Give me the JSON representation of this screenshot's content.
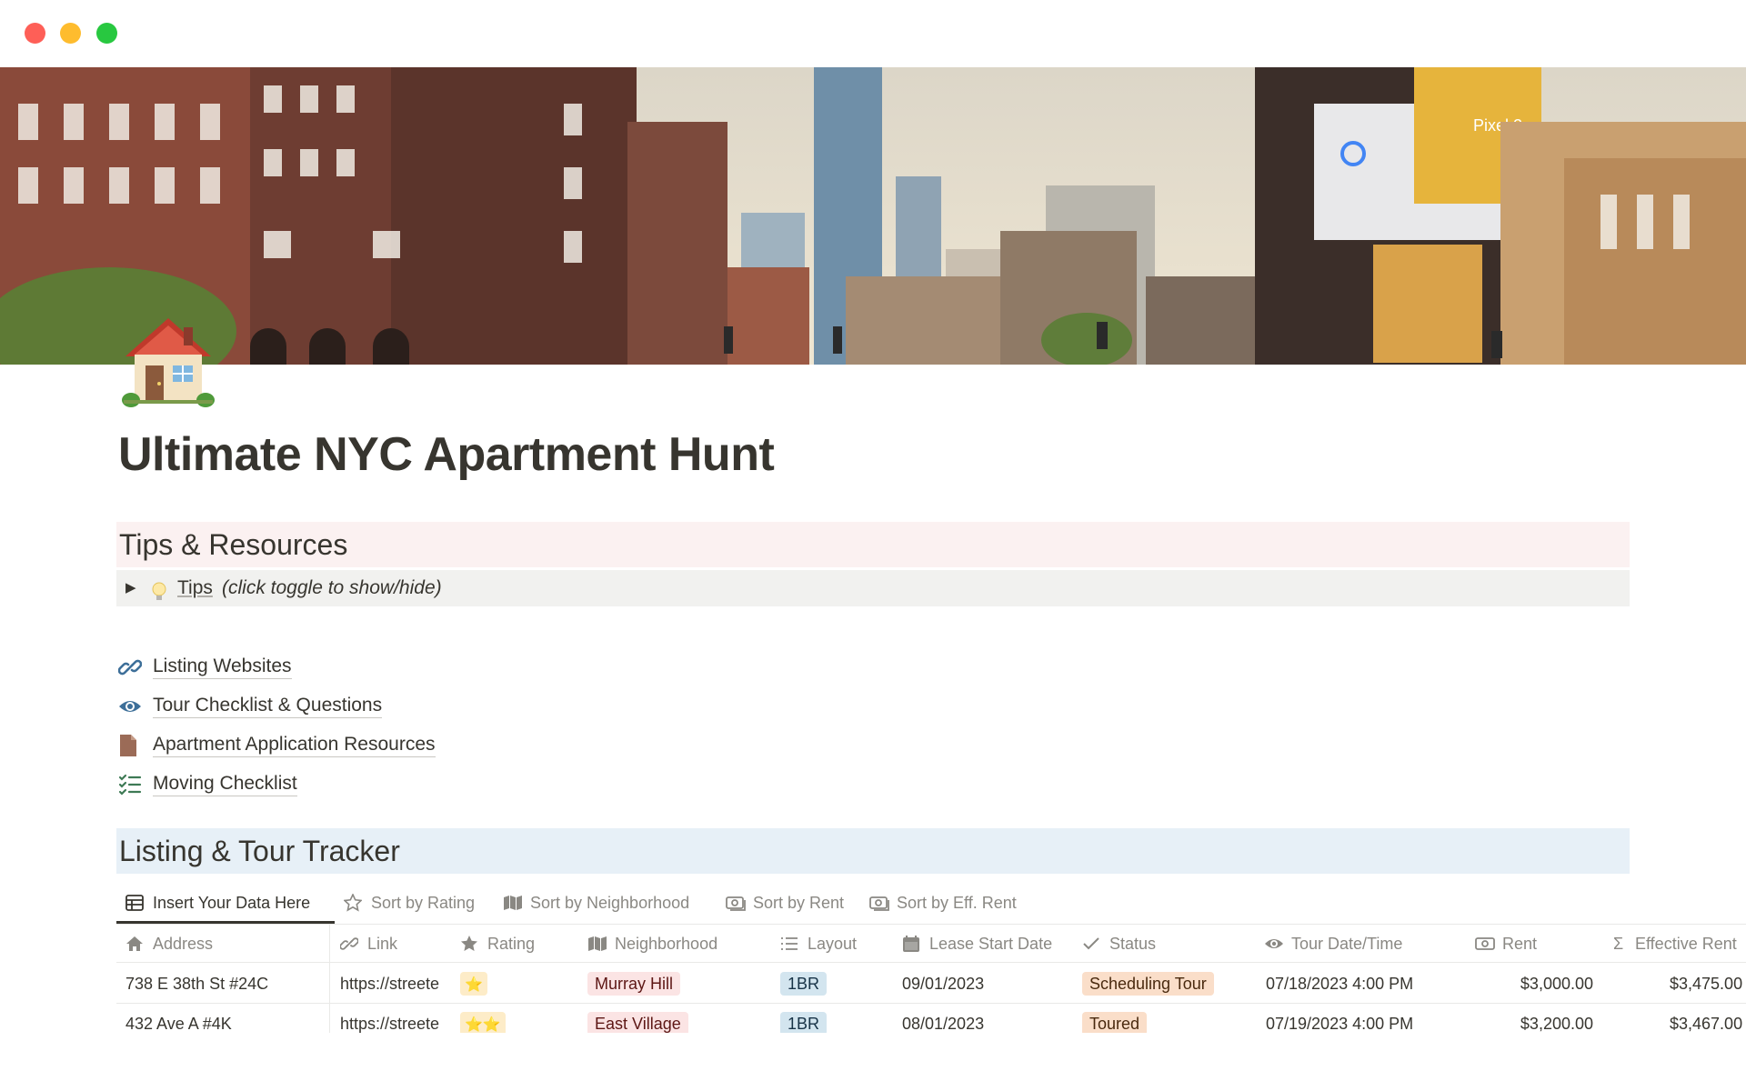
{
  "window": {
    "controls": [
      "close",
      "minimize",
      "zoom"
    ]
  },
  "cover": {
    "description_icon": "nyc-street-cover-image",
    "billboard_text": "Pixel 2"
  },
  "page": {
    "icon": "house-icon",
    "title": "Ultimate NYC Apartment Hunt"
  },
  "tips_section": {
    "heading": "Tips & Resources",
    "toggle": {
      "bulb_icon": "lightbulb-icon",
      "label": "Tips",
      "hint": "(click toggle to show/hide)"
    }
  },
  "resource_links": [
    {
      "icon": "link-icon",
      "label": "Listing Websites"
    },
    {
      "icon": "eye-icon",
      "label": "Tour Checklist & Questions"
    },
    {
      "icon": "document-icon",
      "label": "Apartment Application Resources"
    },
    {
      "icon": "checklist-icon",
      "label": "Moving Checklist"
    }
  ],
  "tracker_section": {
    "heading": "Listing & Tour Tracker",
    "views": [
      {
        "icon": "table-icon",
        "label": "Insert Your Data Here",
        "active": true
      },
      {
        "icon": "star-icon",
        "label": "Sort by Rating",
        "active": false
      },
      {
        "icon": "map-icon",
        "label": "Sort by Neighborhood",
        "active": false
      },
      {
        "icon": "money-icon",
        "label": "Sort by Rent",
        "active": false
      },
      {
        "icon": "money-icon",
        "label": "Sort by Eff. Rent",
        "active": false
      }
    ],
    "columns": [
      {
        "icon": "house-outline-icon",
        "label": "Address"
      },
      {
        "icon": "link-icon",
        "label": "Link"
      },
      {
        "icon": "star-icon",
        "label": "Rating"
      },
      {
        "icon": "map-icon",
        "label": "Neighborhood"
      },
      {
        "icon": "list-icon",
        "label": "Layout"
      },
      {
        "icon": "calendar-icon",
        "label": "Lease Start Date"
      },
      {
        "icon": "check-icon",
        "label": "Status"
      },
      {
        "icon": "eye-icon",
        "label": "Tour Date/Time"
      },
      {
        "icon": "money-icon",
        "label": "Rent"
      },
      {
        "icon": "sigma-icon",
        "label": "Effective Rent"
      }
    ],
    "rows": [
      {
        "address": "738 E 38th St #24C",
        "link": "https://streete",
        "rating": 1,
        "neighborhood": "Murray Hill",
        "layout": "1BR",
        "lease_start": "09/01/2023",
        "status": "Scheduling Tour",
        "tour_datetime": "07/18/2023 4:00 PM",
        "rent": "$3,000.00",
        "effective_rent": "$3,475.00"
      },
      {
        "address": "432 Ave A #4K",
        "link": "https://streete",
        "rating": 2,
        "neighborhood": "East Village",
        "layout": "1BR",
        "lease_start": "08/01/2023",
        "status": "Toured",
        "tour_datetime": "07/19/2023 4:00 PM",
        "rent": "$3,200.00",
        "effective_rent": "$3,467.00"
      }
    ],
    "colors": {
      "tag_red": "#fbe4e4",
      "tag_blue": "#d3e5ef",
      "tag_orange": "#fadec9",
      "tag_yellow": "#fdecc8"
    }
  }
}
